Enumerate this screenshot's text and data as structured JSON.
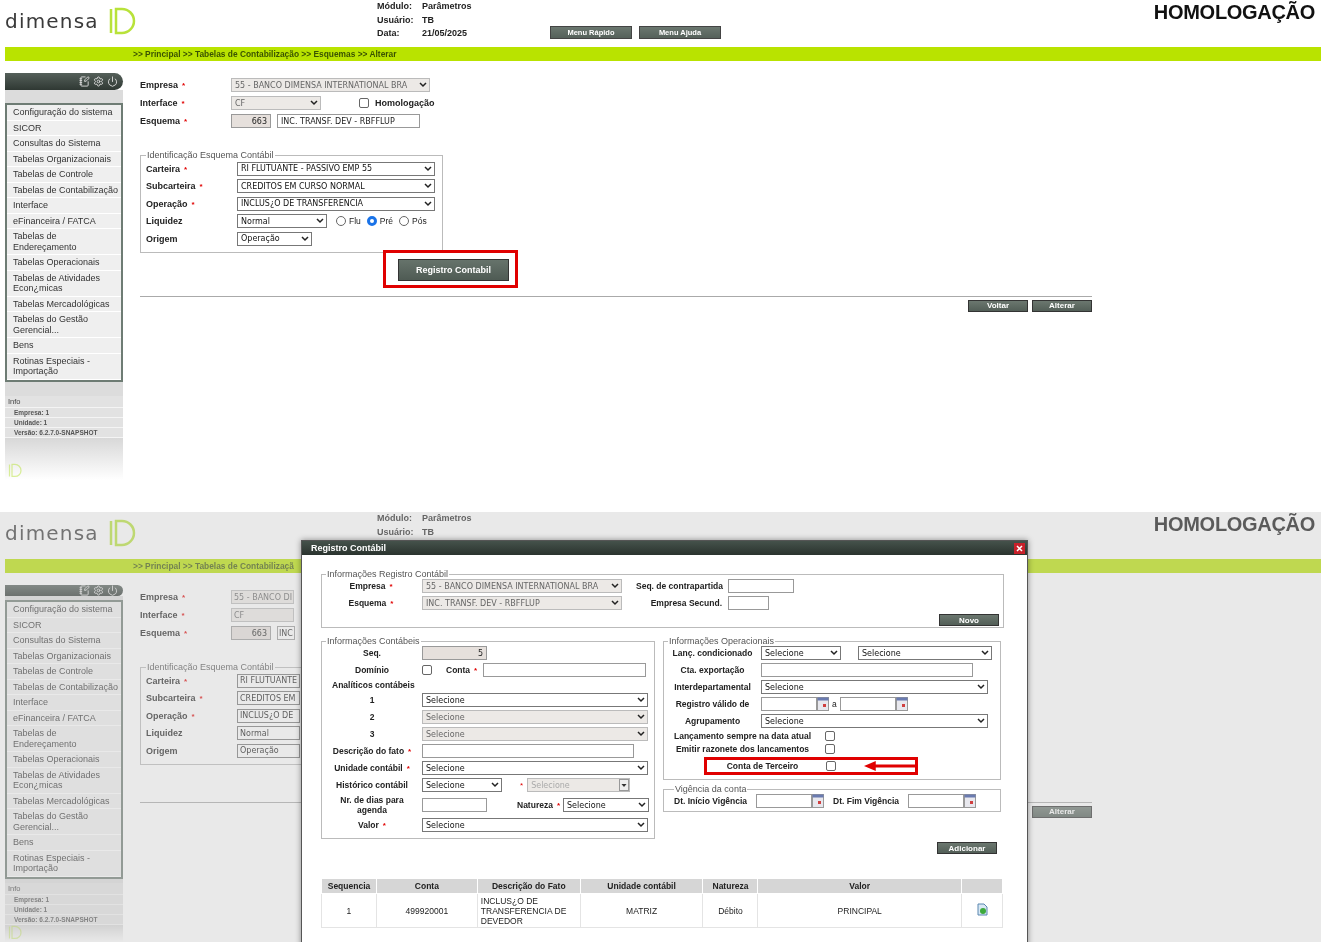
{
  "screens": [
    {
      "dimmed": false,
      "header": {
        "logo": "dimensa",
        "info": [
          {
            "label": "Módulo:",
            "value": "Parâmetros"
          },
          {
            "label": "Usuário:",
            "value": "TB"
          },
          {
            "label": "Data:",
            "value": "21/05/2025"
          }
        ],
        "buttons": [
          "Menu Rápido",
          "Menu Ajuda"
        ],
        "environment": "HOMOLOGAÇÃO"
      },
      "breadcrumb": ">> Principal >> Tabelas de Contabilização >> Esquemas >> Alterar",
      "sidebar": {
        "menu": [
          "Configuração do sistema",
          "SICOR",
          "Consultas do Sistema",
          "Tabelas Organizacionais",
          "Tabelas de Controle",
          "Tabelas de Contabilização",
          "Interface",
          "eFinanceira / FATCA",
          "Tabelas de Endereçamento",
          "Tabelas Operacionais",
          "Tabelas de Atividades Econ¿micas",
          "Tabelas Mercadológicas",
          "Tabelas do Gestão Gerencial...",
          "Bens",
          "Rotinas Especiais - Importação"
        ],
        "info_title": "Info",
        "info_lines": [
          "Empresa: 1",
          "Unidade: 1",
          "Versão: 6.2.7.0-SNAPSHOT"
        ]
      },
      "form": {
        "rows": [
          {
            "kind": "select",
            "label": "Empresa",
            "required_mark": "*",
            "value": "55 - BANCO DIMENSA INTERNATIONAL BRA",
            "disabled": true
          },
          {
            "kind": "select",
            "label": "Interface",
            "required_mark": "*",
            "value": "CF",
            "disabled": true,
            "checkbox": {
              "label": "Homologação",
              "checked": false
            }
          },
          {
            "kind": "code_input",
            "label": "Esquema",
            "required_mark": "*",
            "code": "663",
            "value": "INC. TRANSF. DEV - RBFFLUP"
          }
        ],
        "group": {
          "legend": "Identificação Esquema Contábil",
          "rows": [
            {
              "label": "Carteira",
              "required_mark": "*",
              "value": "RI FLUTUANTE - PASSIVO EMP 55"
            },
            {
              "label": "Subcarteira",
              "required_mark": "*",
              "value": "CREDITOS EM CURSO NORMAL"
            },
            {
              "label": "Operação",
              "required_mark": "*",
              "value": "INCLUS¿O DE TRANSFERENCIA"
            },
            {
              "label": "Liquidez",
              "value": "Normal",
              "radios": [
                {
                  "label": "Flu",
                  "selected": false
                },
                {
                  "label": "Pré",
                  "selected": true
                },
                {
                  "label": "Pós",
                  "selected": false
                }
              ]
            },
            {
              "label": "Origem",
              "value": "Operação"
            }
          ]
        },
        "action_button": {
          "label": "Registro Contabil",
          "annotated": true
        },
        "buttons": [
          "Voltar",
          "Alterar"
        ]
      }
    },
    {
      "dimmed": true,
      "header": {
        "logo": "dimensa",
        "info": [
          {
            "label": "Módulo:",
            "value": "Parâmetros"
          },
          {
            "label": "Usuário:",
            "value": "TB"
          }
        ],
        "environment": "HOMOLOGAÇÃO"
      },
      "breadcrumb": ">> Principal >> Tabelas de Contabilizaçã",
      "sidebar": {
        "menu": [
          "Configuração do sistema",
          "SICOR",
          "Consultas do Sistema",
          "Tabelas Organizacionais",
          "Tabelas de Controle",
          "Tabelas de Contabilização",
          "Interface",
          "eFinanceira / FATCA",
          "Tabelas de Endereçamento",
          "Tabelas Operacionais",
          "Tabelas de Atividades Econ¿micas",
          "Tabelas Mercadológicas",
          "Tabelas do Gestão Gerencial...",
          "Bens",
          "Rotinas Especiais - Importação"
        ],
        "info_title": "Info",
        "info_lines": [
          "Empresa: 1",
          "Unidade: 1",
          "Versão: 6.2.7.0-SNAPSHOT"
        ]
      },
      "form": {
        "rows": [
          {
            "kind": "select",
            "label": "Empresa",
            "required_mark": "*",
            "value": "55 - BANCO DI",
            "disabled": true
          },
          {
            "kind": "select",
            "label": "Interface",
            "required_mark": "*",
            "value": "CF",
            "disabled": true
          },
          {
            "kind": "code_input",
            "label": "Esquema",
            "required_mark": "*",
            "code": "663",
            "value": "INC"
          }
        ],
        "group": {
          "legend": "Identificação Esquema Contábil",
          "rows": [
            {
              "label": "Carteira",
              "required_mark": "*",
              "value": "RI FLUTUANTE"
            },
            {
              "label": "Subcarteira",
              "required_mark": "*",
              "value": "CREDITOS EM"
            },
            {
              "label": "Operação",
              "required_mark": "*",
              "value": "INCLUS¿O DE"
            },
            {
              "label": "Liquidez",
              "value": "Normal"
            },
            {
              "label": "Origem",
              "value": "Operação"
            }
          ]
        },
        "buttons": [
          "Alterar"
        ]
      },
      "dialog": {
        "title": "Registro Contábil",
        "header_group": {
          "legend": "Informações Registro Contábil",
          "fields": [
            {
              "label": "Empresa",
              "required_mark": "*",
              "value": "55 - BANCO DIMENSA INTERNATIONAL BRA",
              "disabled": true
            },
            {
              "label": "Esquema",
              "required_mark": "*",
              "value": "INC. TRANSF. DEV - RBFFLUP",
              "disabled": true
            }
          ],
          "side_fields": [
            {
              "label": "Seq. de contrapartida"
            },
            {
              "label": "Empresa Secund."
            }
          ],
          "button": "Novo"
        },
        "accounting_group": {
          "legend": "Informações Contábeis",
          "rows": [
            {
              "kind": "readonly",
              "label": "Seq.",
              "value": "5"
            },
            {
              "kind": "check_input",
              "label": "Domínio",
              "checked": false,
              "input_label": "Conta",
              "required_mark": "*"
            },
            {
              "kind": "heading",
              "label": "Analíticos contábeis"
            },
            {
              "kind": "select",
              "label": "1",
              "value": "Selecione",
              "disabled": false
            },
            {
              "kind": "select",
              "label": "2",
              "value": "Selecione",
              "disabled": true
            },
            {
              "kind": "select",
              "label": "3",
              "value": "Selecione",
              "disabled": true
            },
            {
              "kind": "input",
              "label": "Descrição do fato",
              "required_mark": "*"
            },
            {
              "kind": "select",
              "label": "Unidade contábil",
              "required_mark": "*",
              "value": "Selecione",
              "disabled": false
            },
            {
              "kind": "select_pair",
              "label": "Histórico contábil",
              "value": "Selecione",
              "second": {
                "required_mark": "*",
                "value": "Selecione",
                "disabled": true
              }
            },
            {
              "kind": "input_select",
              "label": "Nr. de dias para agenda",
              "second": {
                "label": "Natureza",
                "required_mark": "*",
                "value": "Selecione"
              }
            },
            {
              "kind": "select",
              "label": "Valor",
              "required_mark": "*",
              "value": "Selecione",
              "disabled": false
            }
          ]
        },
        "operational_group": {
          "legend": "Informações Operacionais",
          "rows": [
            {
              "kind": "select_pair",
              "label": "Lanç. condicionado",
              "value": "Selecione",
              "second": {
                "value": "Selecione",
                "disabled": false
              }
            },
            {
              "kind": "input",
              "label": "Cta. exportação"
            },
            {
              "kind": "select",
              "label": "Interdepartamental",
              "value": "Selecione",
              "disabled": false
            },
            {
              "kind": "date_range",
              "label": "Registro válido de",
              "separator": "a"
            },
            {
              "kind": "select",
              "label": "Agrupamento",
              "value": "Selecione",
              "disabled": false
            },
            {
              "kind": "checkbox",
              "label": "Lançamento sempre na data atual",
              "checked": false,
              "annotated": false
            },
            {
              "kind": "checkbox",
              "label": "Emitir razonete dos lancamentos",
              "checked": false,
              "annotated": false
            },
            {
              "kind": "checkbox",
              "label": "Conta de Terceiro",
              "checked": false,
              "annotated": true
            }
          ]
        },
        "validity_group": {
          "legend": "Vigência da conta",
          "fields": [
            {
              "label": "Dt. Início Vigência"
            },
            {
              "label": "Dt. Fim Vigência"
            }
          ]
        },
        "add_button": "Adicionar",
        "table": {
          "columns": [
            "Sequencia",
            "Conta",
            "Descrição do Fato",
            "Unidade contábil",
            "Natureza",
            "Valor"
          ],
          "rows": [
            {
              "cells": [
                "1",
                "499920001",
                "INCLUS¿O DE TRANSFERENCIA DE DEVEDOR",
                "MATRIZ",
                "Débito",
                "PRINCIPAL"
              ]
            }
          ]
        }
      }
    }
  ]
}
